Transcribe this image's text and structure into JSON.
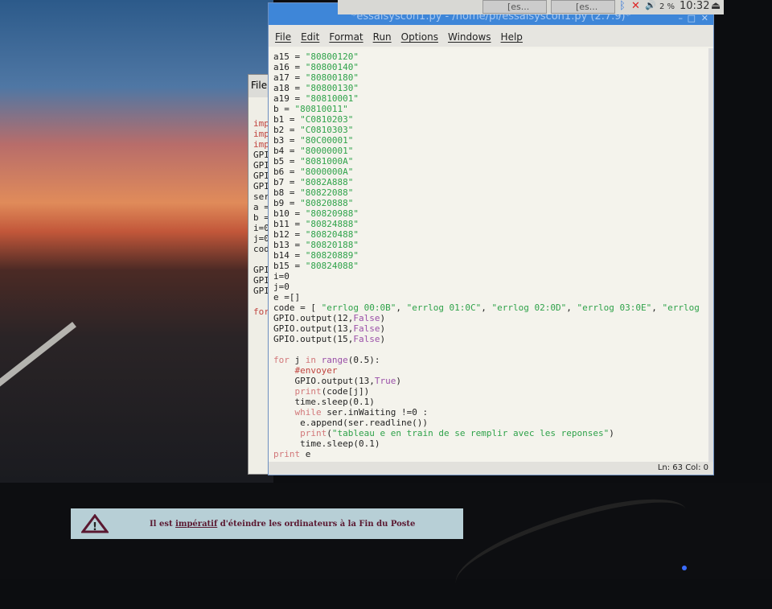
{
  "taskbar": {
    "tasks": [
      "[es...",
      "[es..."
    ],
    "cpu": "2 %",
    "clock": "10:32"
  },
  "window": {
    "title": "*essaisyscon1.py - /home/pi/essaisyscon1.py (2.7.9)*",
    "menu": [
      "File",
      "Edit",
      "Format",
      "Run",
      "Options",
      "Windows",
      "Help"
    ],
    "status": "Ln: 63 Col: 0"
  },
  "background_window": {
    "menu": "File",
    "lines": [
      "imp",
      "imp",
      "imp",
      "GPI",
      "GPI",
      "GPI",
      "GPI",
      "ser",
      "a =",
      "b =",
      "i=0",
      "j=0",
      "cod",
      "",
      "GPI",
      "GPI",
      "GPI",
      "",
      "for"
    ]
  },
  "code_lines": [
    [
      [
        "a15 = ",
        ""
      ],
      [
        "\"80800120\"",
        "s"
      ]
    ],
    [
      [
        "a16 = ",
        ""
      ],
      [
        "\"80800140\"",
        "s"
      ]
    ],
    [
      [
        "a17 = ",
        ""
      ],
      [
        "\"80800180\"",
        "s"
      ]
    ],
    [
      [
        "a18 = ",
        ""
      ],
      [
        "\"80800130\"",
        "s"
      ]
    ],
    [
      [
        "a19 = ",
        ""
      ],
      [
        "\"80810001\"",
        "s"
      ]
    ],
    [
      [
        "b = ",
        ""
      ],
      [
        "\"80810011\"",
        "s"
      ]
    ],
    [
      [
        "b1 = ",
        ""
      ],
      [
        "\"C0810203\"",
        "s"
      ]
    ],
    [
      [
        "b2 = ",
        ""
      ],
      [
        "\"C0810303\"",
        "s"
      ]
    ],
    [
      [
        "b3 = ",
        ""
      ],
      [
        "\"80C00001\"",
        "s"
      ]
    ],
    [
      [
        "b4 = ",
        ""
      ],
      [
        "\"80000001\"",
        "s"
      ]
    ],
    [
      [
        "b5 = ",
        ""
      ],
      [
        "\"8081000A\"",
        "s"
      ]
    ],
    [
      [
        "b6 = ",
        ""
      ],
      [
        "\"8000000A\"",
        "s"
      ]
    ],
    [
      [
        "b7 = ",
        ""
      ],
      [
        "\"8082A888\"",
        "s"
      ]
    ],
    [
      [
        "b8 = ",
        ""
      ],
      [
        "\"80822088\"",
        "s"
      ]
    ],
    [
      [
        "b9 = ",
        ""
      ],
      [
        "\"80820888\"",
        "s"
      ]
    ],
    [
      [
        "b10 = ",
        ""
      ],
      [
        "\"80820988\"",
        "s"
      ]
    ],
    [
      [
        "b11 = ",
        ""
      ],
      [
        "\"80824888\"",
        "s"
      ]
    ],
    [
      [
        "b12 = ",
        ""
      ],
      [
        "\"80820488\"",
        "s"
      ]
    ],
    [
      [
        "b13 = ",
        ""
      ],
      [
        "\"80820188\"",
        "s"
      ]
    ],
    [
      [
        "b14 = ",
        ""
      ],
      [
        "\"80820889\"",
        "s"
      ]
    ],
    [
      [
        "b15 = ",
        ""
      ],
      [
        "\"80824088\"",
        "s"
      ]
    ],
    [
      [
        "i=0",
        ""
      ]
    ],
    [
      [
        "j=0",
        ""
      ]
    ],
    [
      [
        "e =[]",
        ""
      ]
    ],
    [
      [
        "code = [ ",
        ""
      ],
      [
        "\"errlog 00:0B\"",
        "s"
      ],
      [
        ", ",
        ""
      ],
      [
        "\"errlog 01:0C\"",
        "s"
      ],
      [
        ", ",
        ""
      ],
      [
        "\"errlog 02:0D\"",
        "s"
      ],
      [
        ", ",
        ""
      ],
      [
        "\"errlog 03:0E\"",
        "s"
      ],
      [
        ", ",
        ""
      ],
      [
        "\"errlog",
        "s"
      ]
    ],
    [
      [
        "GPIO.output(12,",
        ""
      ],
      [
        "False",
        "b"
      ],
      [
        ")",
        ""
      ]
    ],
    [
      [
        "GPIO.output(13,",
        ""
      ],
      [
        "False",
        "b"
      ],
      [
        ")",
        ""
      ]
    ],
    [
      [
        "GPIO.output(15,",
        ""
      ],
      [
        "False",
        "b"
      ],
      [
        ")",
        ""
      ]
    ],
    [],
    [
      [
        "for",
        "k"
      ],
      [
        " j ",
        ""
      ],
      [
        "in",
        "k"
      ],
      [
        " ",
        ""
      ],
      [
        "range",
        "b"
      ],
      [
        "(0.5):",
        ""
      ]
    ],
    [
      [
        "    ",
        ""
      ],
      [
        "#envoyer",
        "c"
      ]
    ],
    [
      [
        "    GPIO.output(13,",
        ""
      ],
      [
        "True",
        "b"
      ],
      [
        ")",
        ""
      ]
    ],
    [
      [
        "    ",
        ""
      ],
      [
        "print",
        "k"
      ],
      [
        "(code[j])",
        ""
      ]
    ],
    [
      [
        "    time.sleep(0.1)",
        ""
      ]
    ],
    [
      [
        "    ",
        ""
      ],
      [
        "while",
        "k"
      ],
      [
        " ser.inWaiting !=0 :",
        ""
      ]
    ],
    [
      [
        "     e.append(ser.readline())",
        ""
      ]
    ],
    [
      [
        "     ",
        ""
      ],
      [
        "print",
        "k"
      ],
      [
        "(",
        ""
      ],
      [
        "\"tableau e en train de se remplir avec les reponses\"",
        "s"
      ],
      [
        ")",
        ""
      ]
    ],
    [
      [
        "     time.sleep(0.1)",
        ""
      ]
    ],
    [
      [
        "print",
        "k"
      ],
      [
        " e",
        ""
      ]
    ]
  ],
  "sticker": {
    "prefix": "Il est ",
    "emph": "impératif",
    "suffix": " d'éteindre les ordinateurs à la Fin du Poste"
  }
}
